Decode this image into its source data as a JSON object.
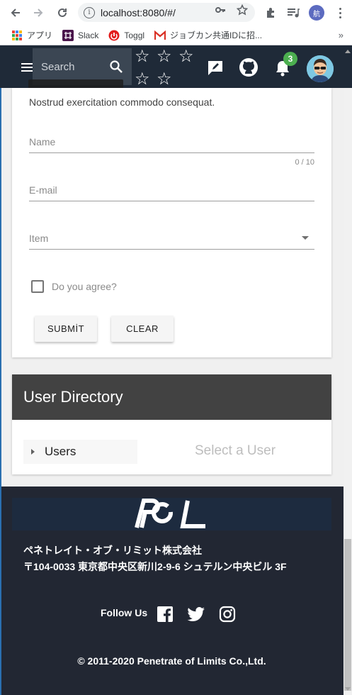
{
  "browser": {
    "url": "localhost:8080/#/",
    "profile_initial": "航",
    "icons": [
      "back-icon",
      "forward-icon",
      "reload-icon",
      "info-icon",
      "key-icon",
      "star-icon",
      "extensions-icon",
      "media-icon"
    ]
  },
  "bookmarks": {
    "items": [
      {
        "label": "アプリ",
        "icon": "apps-icon"
      },
      {
        "label": "Slack",
        "icon": "slack-icon"
      },
      {
        "label": "Toggl",
        "icon": "toggl-icon"
      },
      {
        "label": "ジョブカン共通IDに招...",
        "icon": "gmail-icon"
      }
    ],
    "more": "»"
  },
  "appbar": {
    "search_placeholder": "Search",
    "rating_stars": 5,
    "notification_count": "3",
    "colors": {
      "bar": "#1f2a38",
      "badge": "#4caf50"
    }
  },
  "form": {
    "subtitle": "Nostrud exercitation commodo consequat.",
    "name_label": "Name",
    "name_counter": "0 / 10",
    "email_label": "E-mail",
    "item_label": "Item",
    "agree_label": "Do you agree?",
    "submit_label": "SUBMİT",
    "clear_label": "CLEAR"
  },
  "directory": {
    "title": "User Directory",
    "tree_item": "Users",
    "placeholder": "Select a User"
  },
  "footer": {
    "logo_text": "POL",
    "company": "ペネトレイト・オブ・リミット株式会社",
    "address": "〒104-0033 東京都中央区新川2-9-6 シュテルン中央ビル 3F",
    "follow_label": "Follow Us",
    "social": [
      "facebook-icon",
      "twitter-icon",
      "instagram-icon"
    ],
    "copyright": "© 2011-2020 Penetrate of Limits Co.,Ltd."
  }
}
